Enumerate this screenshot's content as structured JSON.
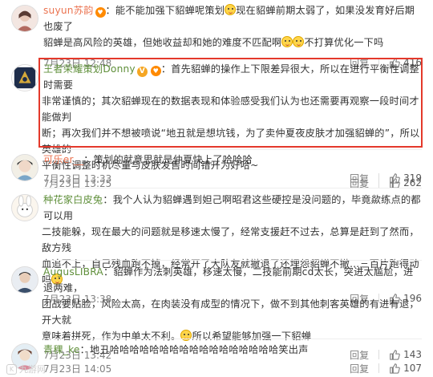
{
  "reply_label": "回复",
  "like_icon": "thumbs-up-icon",
  "comments": [
    {
      "user": "suyun苏韵",
      "badges": [
        "heart"
      ],
      "avatar": "suyun-avatar",
      "lines": [
        "：能不能加强下貂蝉呢策划",
        "现在貂蝉前期太弱了，如果没发育好后期也废了",
        "貂蝉是高风险的英雄，但她收益却和她的难度不匹配啊",
        "不打算优化一下吗"
      ],
      "date": "7月23日 12:48",
      "likes": "416"
    },
    {
      "user": "王者荣耀策划Donny",
      "badges": [
        "v",
        "heart"
      ],
      "avatar": "donny-avatar",
      "lines": [
        "：首先貂蝉的操作上下限差异很大，所以在进行平衡性调整时需要",
        "非常谨慎的；其次貂蝉现在的数据表现和体验感受我们认为也还需要再观察一段时间才能做判",
        "断；再次我们并不想被喷说“地丑就是想坑钱，为了卖仲夏夜皮肤才加强貂蝉的”，所以英雄的",
        "平衡性调整时机尽量与皮肤发售时间错开为好哈~"
      ],
      "date": "7月23日 13:25",
      "likes": "262"
    },
    {
      "user": "可乐er__",
      "badges": [],
      "avatar": "kele-avatar",
      "lines": [
        "：策划的就意思就是仲夏快上了哈哈哈"
      ],
      "date": "7月23日 13:33",
      "likes": "319"
    },
    {
      "user": "种花家白皮兔",
      "badges": [],
      "avatar": "rabbit-avatar",
      "lines": [
        "：我个人认为貂蝉遇到妲己啊昭君这些硬控是没问题的，毕竟歘练点的都可以用",
        "二技能躲，现在最大的问题就是移速太慢了，经常支援赶不过去，总算是赶到了然而，敌方残",
        "血追不上，自己残血跑不掉，经常开了大队友就撤退了还埋怨貂蝉不撤…三百片跑得动吗"
      ],
      "date": "7月23日 13:38",
      "likes": "196"
    },
    {
      "user": "AugusLIBRA",
      "badges": [],
      "avatar": "augus-avatar",
      "lines": [
        "：貂蝉作为法刺英雄，移速太慢，二技能前期cd太长，突进太尴尬，进退两难，",
        "团战要贴脸，风险太高，在肉装没有成型的情况下，做不到其他刺客英雄的有进有退，开大就",
        "意味着拼死，作为中单太不利。",
        "所以希望能够加强一下貂蝉"
      ],
      "date": "7月23日 13:42",
      "likes": "143"
    },
    {
      "user": "青稞_ke",
      "badges": [],
      "avatar": "qingke-avatar",
      "lines": [
        "：地丑哈哈哈哈哈哈哈哈哈哈哈哈哈哈哈哈哈笑出声"
      ],
      "date": "7月23日 14:05",
      "likes": "107"
    }
  ],
  "watermark": "九游网"
}
